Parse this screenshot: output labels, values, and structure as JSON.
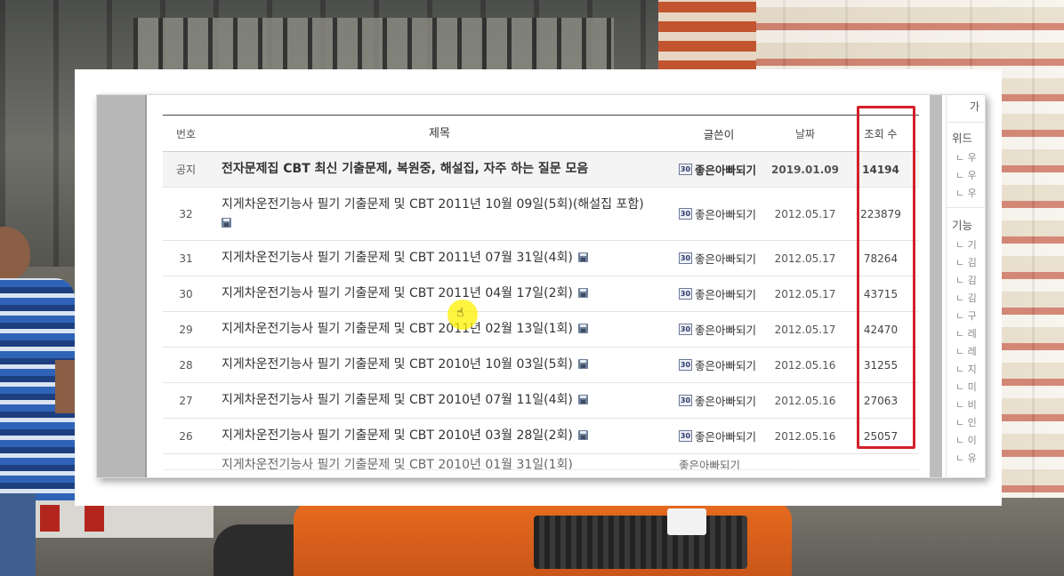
{
  "table": {
    "headers": {
      "num": "번호",
      "title": "제목",
      "author": "글쓴이",
      "date": "날짜",
      "views": "조회 수"
    },
    "author_badge": "30",
    "rows": [
      {
        "num": "공지",
        "title": "전자문제집 CBT 최신 기출문제, 복원중, 해설집, 자주 하는 질문 모음",
        "author": "좋은아빠되기",
        "date": "2019.01.09",
        "views": "14194",
        "has_disk": false
      },
      {
        "num": "32",
        "title": "지게차운전기능사 필기 기출문제 및 CBT 2011년 10월 09일(5회)(해설집 포함)",
        "author": "좋은아빠되기",
        "date": "2012.05.17",
        "views": "223879",
        "has_disk": true
      },
      {
        "num": "31",
        "title": "지게차운전기능사 필기 기출문제 및 CBT 2011년 07월 31일(4회)",
        "author": "좋은아빠되기",
        "date": "2012.05.17",
        "views": "78264",
        "has_disk": true
      },
      {
        "num": "30",
        "title": "지게차운전기능사 필기 기출문제 및 CBT 2011년 04월 17일(2회)",
        "author": "좋은아빠되기",
        "date": "2012.05.17",
        "views": "43715",
        "has_disk": true
      },
      {
        "num": "29",
        "title": "지게차운전기능사 필기 기출문제 및 CBT 2011년 02월 13일(1회)",
        "author": "좋은아빠되기",
        "date": "2012.05.17",
        "views": "42470",
        "has_disk": true
      },
      {
        "num": "28",
        "title": "지게차운전기능사 필기 기출문제 및 CBT 2010년 10월 03일(5회)",
        "author": "좋은아빠되기",
        "date": "2012.05.16",
        "views": "31255",
        "has_disk": true
      },
      {
        "num": "27",
        "title": "지게차운전기능사 필기 기출문제 및 CBT 2010년 07월 11일(4회)",
        "author": "좋은아빠되기",
        "date": "2012.05.16",
        "views": "27063",
        "has_disk": true
      },
      {
        "num": "26",
        "title": "지게차운전기능사 필기 기출문제 및 CBT 2010년 03월 28일(2회)",
        "author": "좋은아빠되기",
        "date": "2012.05.16",
        "views": "25057",
        "has_disk": true
      }
    ],
    "partial_row": {
      "title": "지게차운전기능사 필기 기출문제 및 CBT 2010년 01월 31일(1회)",
      "author": "좋은아빠되기"
    }
  },
  "sidebar": {
    "top_char": "가",
    "widget_heading": "위드",
    "feature_heading": "기능",
    "items": [
      "ㄴ 우",
      "ㄴ 우",
      "ㄴ 우",
      "ㄴ 기",
      "ㄴ 김",
      "ㄴ 김",
      "ㄴ 김",
      "ㄴ 구",
      "ㄴ 레",
      "ㄴ 레",
      "ㄴ 지",
      "ㄴ 미",
      "ㄴ 비",
      "ㄴ 인",
      "ㄴ 이",
      "ㄴ 유"
    ]
  },
  "colors": {
    "highlight": "#d4202a",
    "cursor_glow": "#fff000"
  },
  "icons": {
    "disk": "floppy-disk-icon",
    "avatar": "member-level-icon",
    "cursor": "hand-pointer-icon"
  }
}
